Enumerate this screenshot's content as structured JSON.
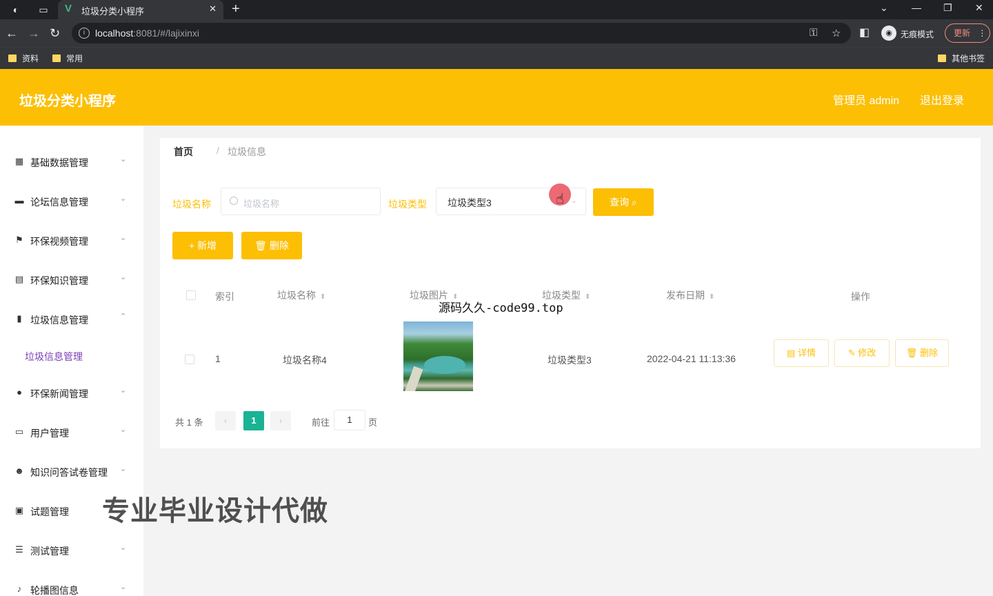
{
  "browser": {
    "tab_title": "垃圾分类小程序",
    "tab_favicon": "V",
    "url_host": "localhost",
    "url_rest": ":8081/#/lajixinxi",
    "incognito_label": "无痕模式",
    "update_label": "更新",
    "bookmarks": [
      "资料",
      "常用"
    ],
    "other_bookmarks": "其他书签"
  },
  "header": {
    "title": "垃圾分类小程序",
    "admin": "管理员 admin",
    "logout": "退出登录"
  },
  "sidebar": {
    "items": [
      {
        "label": "基础数据管理",
        "icon": "grid-icon"
      },
      {
        "label": "论坛信息管理",
        "icon": "monitor-icon"
      },
      {
        "label": "环保视频管理",
        "icon": "flag-icon"
      },
      {
        "label": "环保知识管理",
        "icon": "document-icon"
      },
      {
        "label": "垃圾信息管理",
        "icon": "bar-chart-icon"
      },
      {
        "label": "环保新闻管理",
        "icon": "bulb-icon"
      },
      {
        "label": "用户管理",
        "icon": "chat-icon"
      },
      {
        "label": "知识问答试卷管理",
        "icon": "user-icon"
      },
      {
        "label": "试题管理",
        "icon": "camera-icon"
      },
      {
        "label": "测试管理",
        "icon": "list-icon"
      },
      {
        "label": "轮播图信息",
        "icon": "mic-icon"
      }
    ],
    "active_sub": "垃圾信息管理"
  },
  "breadcrumb": {
    "home": "首页",
    "sep": "/",
    "current": "垃圾信息"
  },
  "filters": {
    "name_label": "垃圾名称",
    "name_placeholder": "垃圾名称",
    "type_label": "垃圾类型",
    "type_value": "垃圾类型3",
    "query_button": "查询"
  },
  "actions": {
    "add": "+ 新增",
    "delete": "删除"
  },
  "table": {
    "headers": {
      "index": "索引",
      "name": "垃圾名称",
      "image": "垃圾图片",
      "type": "垃圾类型",
      "date": "发布日期",
      "ops": "操作"
    },
    "rows": [
      {
        "index": "1",
        "name": "垃圾名称4",
        "type": "垃圾类型3",
        "date": "2022-04-21 11:13:36"
      }
    ],
    "row_buttons": {
      "detail": "详情",
      "edit": "修改",
      "delete": "删除"
    }
  },
  "pager": {
    "total": "共 1 条",
    "current_page": "1",
    "goto_label": "前往",
    "goto_value": "1",
    "page_suffix": "页"
  },
  "overlays": {
    "top_text": "源码久久-code99.top",
    "big_text": "专业毕业设计代做"
  }
}
